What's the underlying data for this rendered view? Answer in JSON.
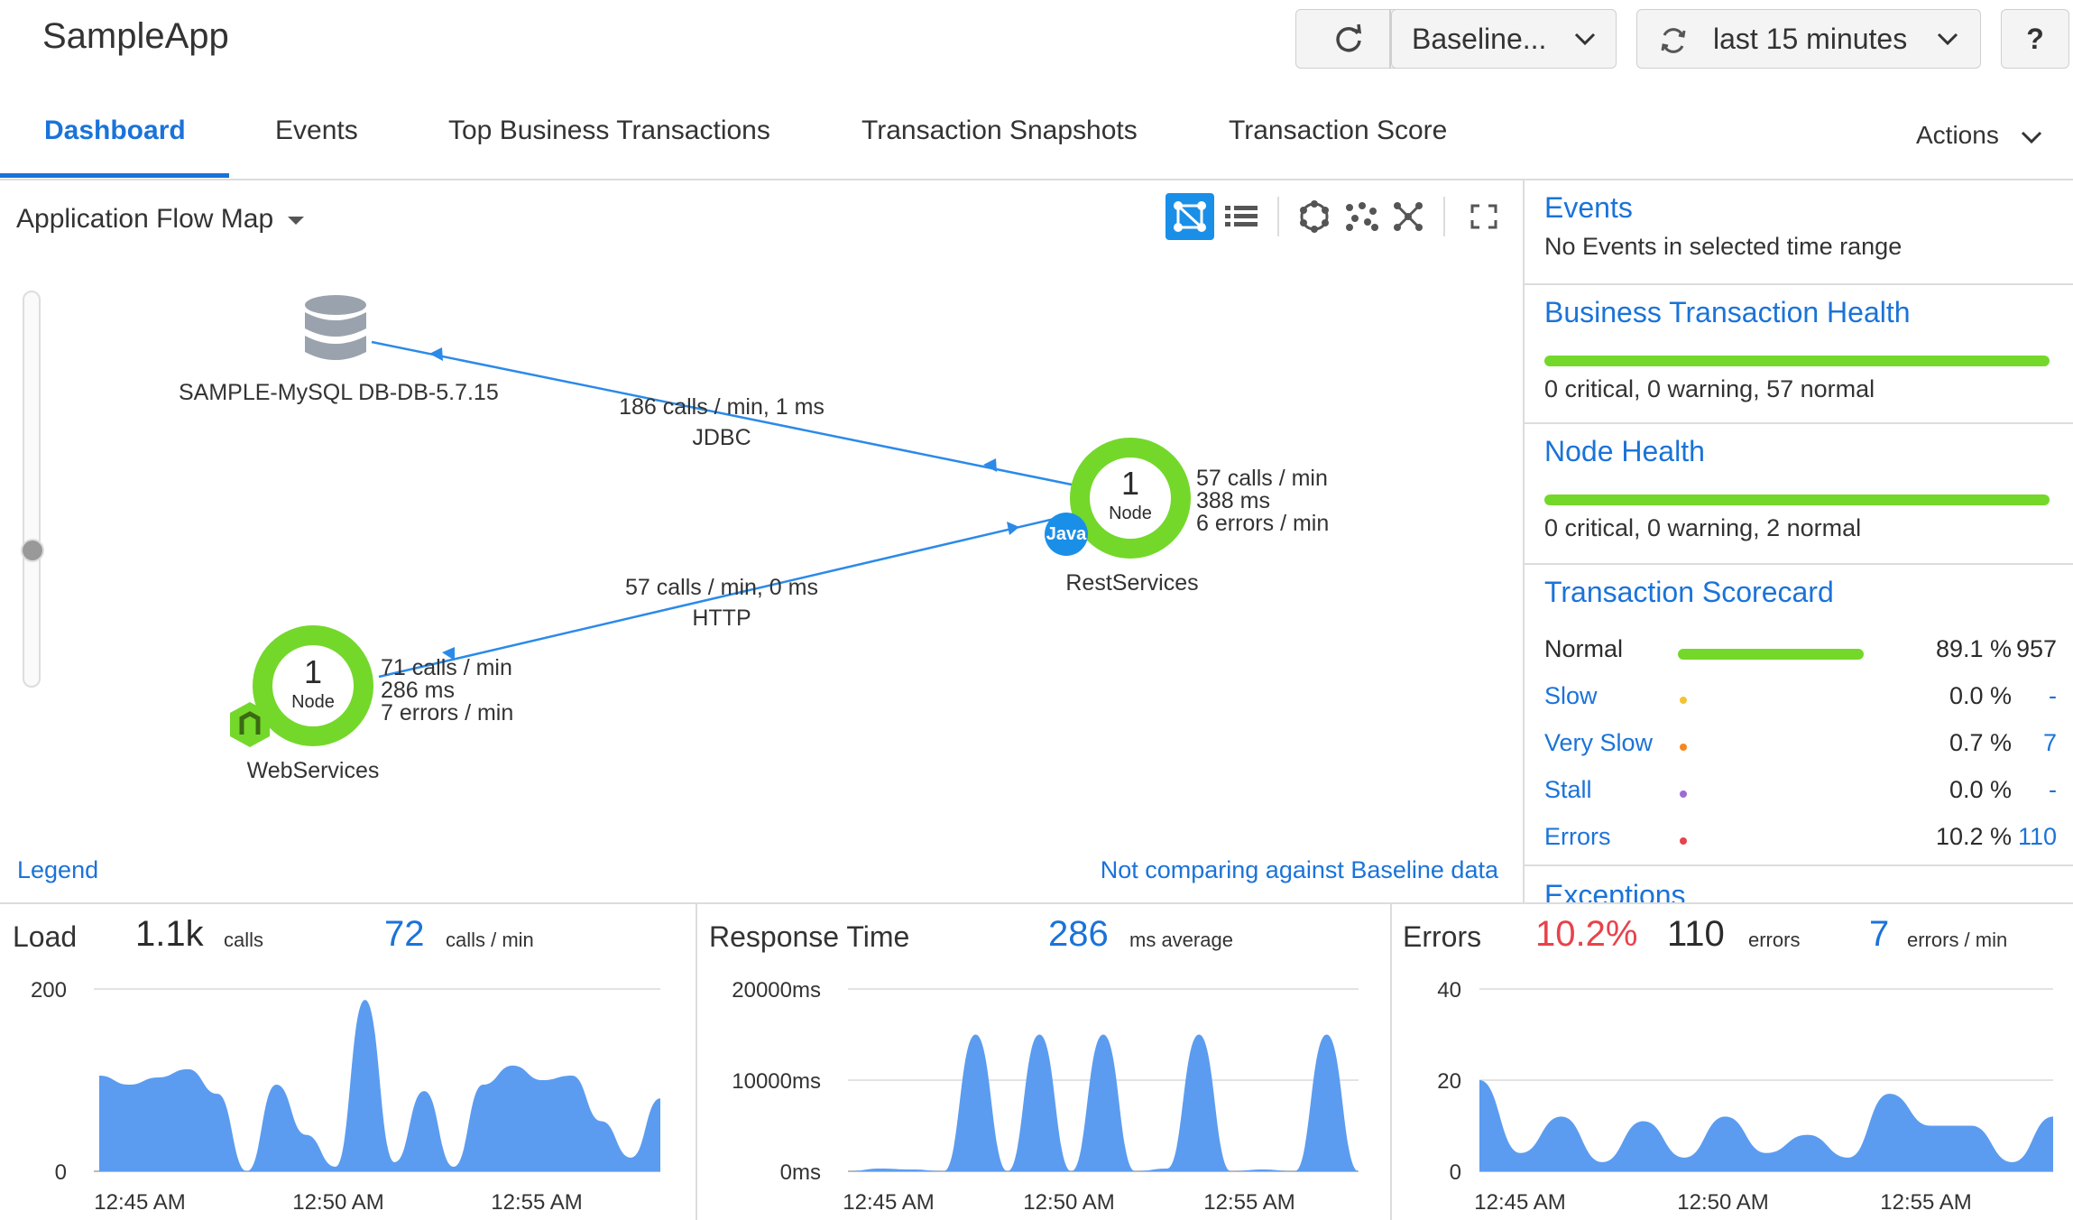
{
  "header": {
    "title": "SampleApp",
    "baseline_label": "Baseline...",
    "time_range_label": "last 15 minutes",
    "help_label": "?"
  },
  "tabs": [
    {
      "label": "Dashboard"
    },
    {
      "label": "Events"
    },
    {
      "label": "Top Business Transactions"
    },
    {
      "label": "Transaction Snapshots"
    },
    {
      "label": "Transaction Score"
    }
  ],
  "actions_label": "Actions",
  "flowmap": {
    "title": "Application Flow Map",
    "legend": "Legend",
    "baseline_note": "Not comparing against Baseline data",
    "db": {
      "label": "SAMPLE-MySQL DB-DB-5.7.15"
    },
    "rest": {
      "name": "RestServices",
      "count": "1",
      "unit": "Node",
      "badge": "Java",
      "stats": [
        "57 calls / min",
        "388 ms",
        "6 errors / min"
      ]
    },
    "web": {
      "name": "WebServices",
      "count": "1",
      "unit": "Node",
      "stats": [
        "71 calls / min",
        "286 ms",
        "7 errors / min"
      ]
    },
    "jdbc_edge": {
      "line1": "186 calls / min, 1 ms",
      "line2": "JDBC"
    },
    "http_edge": {
      "line1": "57 calls / min, 0 ms",
      "line2": "HTTP"
    }
  },
  "side": {
    "events": {
      "title": "Events",
      "text": "No Events in selected time range"
    },
    "bt_health": {
      "title": "Business Transaction Health",
      "text": "0 critical, 0 warning, 57 normal"
    },
    "node_health": {
      "title": "Node Health",
      "text": "0 critical, 0 warning, 2 normal"
    },
    "scorecard": {
      "title": "Transaction Scorecard",
      "rows": [
        {
          "label": "Normal",
          "pct": "89.1 %",
          "count": "957",
          "color": "#74d82b"
        },
        {
          "label": "Slow",
          "pct": "0.0 %",
          "count": "-",
          "color": "#f4c430"
        },
        {
          "label": "Very Slow",
          "pct": "0.7 %",
          "count": "7",
          "color": "#f5871f"
        },
        {
          "label": "Stall",
          "pct": "0.0 %",
          "count": "-",
          "color": "#9b6cd6"
        },
        {
          "label": "Errors",
          "pct": "10.2 %",
          "count": "110",
          "color": "#e8424a"
        }
      ]
    },
    "exceptions_title": "Exceptions"
  },
  "metrics": {
    "load": {
      "label": "Load",
      "value": "1.1k",
      "unit": "calls",
      "rate": "72",
      "rate_unit": "calls / min"
    },
    "response": {
      "label": "Response Time",
      "value": "286",
      "unit": "ms average"
    },
    "errors": {
      "label": "Errors",
      "pct": "10.2%",
      "count": "110",
      "count_unit": "errors",
      "rate": "7",
      "rate_unit": "errors / min"
    }
  },
  "chart_data": [
    {
      "type": "area",
      "title": "Load",
      "x": [
        "12:45 AM",
        "12:50 AM",
        "12:55 AM"
      ],
      "yticks": [
        "200",
        "0"
      ],
      "ylim": [
        0,
        200
      ],
      "values": [
        105,
        95,
        103,
        112,
        85,
        0,
        95,
        40,
        5,
        188,
        10,
        88,
        5,
        95,
        116,
        100,
        105,
        55,
        15,
        80
      ]
    },
    {
      "type": "area",
      "title": "Response Time",
      "x": [
        "12:45 AM",
        "12:50 AM",
        "12:55 AM"
      ],
      "yticks": [
        "20000ms",
        "10000ms",
        "0ms"
      ],
      "ylim": [
        0,
        20000
      ],
      "values": [
        0,
        300,
        200,
        0,
        15000,
        0,
        15000,
        0,
        15000,
        0,
        300,
        15000,
        0,
        200,
        0,
        15000,
        0
      ]
    },
    {
      "type": "area",
      "title": "Errors",
      "x": [
        "12:45 AM",
        "12:50 AM",
        "12:55 AM"
      ],
      "yticks": [
        "40",
        "20",
        "0"
      ],
      "ylim": [
        0,
        40
      ],
      "values": [
        20,
        4,
        12,
        2,
        11,
        3,
        12,
        4,
        8,
        3,
        17,
        10,
        10,
        2,
        12
      ]
    }
  ]
}
